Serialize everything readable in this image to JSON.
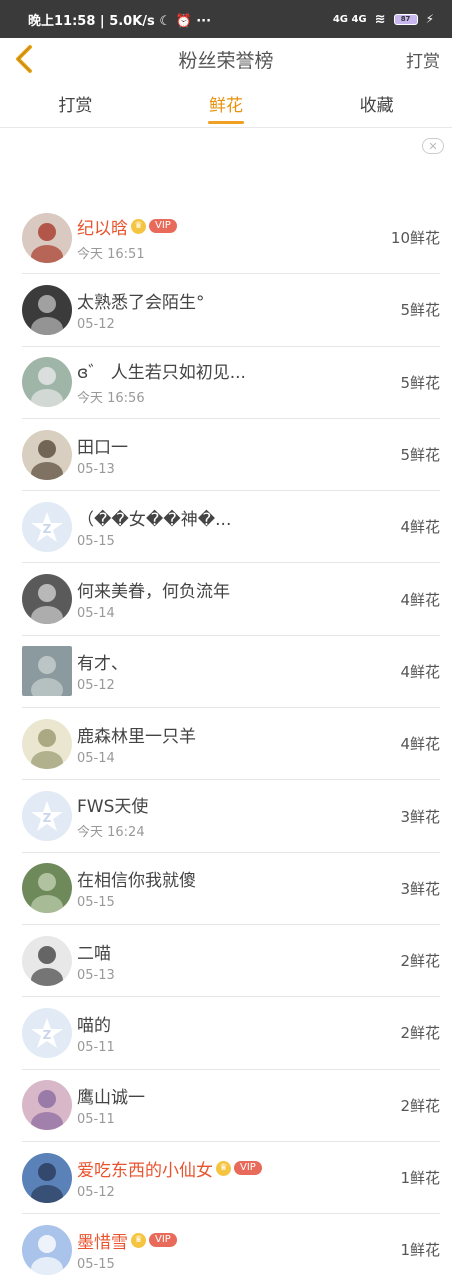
{
  "status_bar": {
    "time": "晚上11:58",
    "speed": "5.0K/s",
    "icons": [
      "moon-icon",
      "alarm-icon",
      "more-icon"
    ],
    "network": "4G 4G",
    "battery": "87"
  },
  "header": {
    "title": "粉丝荣誉榜",
    "right_action": "打赏"
  },
  "tabs": [
    {
      "label": "打赏"
    },
    {
      "label": "鲜花"
    },
    {
      "label": "收藏"
    }
  ],
  "active_tab": "鲜花",
  "ad_close": "✕",
  "vip_label": "VIP",
  "fans": [
    {
      "name": "纪以晗",
      "vip": true,
      "time": "今天 16:51",
      "count": "10鲜花",
      "avatar_bg": "#d9c9c0",
      "avatar_fg": "#a83a2a"
    },
    {
      "name": "太熟悉了会陌生°",
      "vip": false,
      "time": "05-12",
      "count": "5鲜花",
      "avatar_bg": "#3b3b3b",
      "avatar_fg": "#bbbbbb"
    },
    {
      "name": "ɞ゛ 人生若只如初见...",
      "vip": false,
      "time": "今天 16:56",
      "count": "5鲜花",
      "avatar_bg": "#9fb5a8",
      "avatar_fg": "#e8e8e8"
    },
    {
      "name": "田口一",
      "vip": false,
      "time": "05-13",
      "count": "5鲜花",
      "avatar_bg": "#d8cfc0",
      "avatar_fg": "#5a4a3a"
    },
    {
      "name": "（��女��神�...",
      "vip": false,
      "time": "05-15",
      "count": "4鲜花",
      "avatar_bg": "#e4ecf6",
      "avatar_fg": "#ffffff",
      "default_avatar": true
    },
    {
      "name": "何来美眷，何负流年",
      "vip": false,
      "time": "05-14",
      "count": "4鲜花",
      "avatar_bg": "#5a5a5a",
      "avatar_fg": "#d0d0d0"
    },
    {
      "name": "有才、",
      "vip": false,
      "time": "05-12",
      "count": "4鲜花",
      "avatar_bg": "#8a9a9e",
      "avatar_fg": "#c8d0d0",
      "square": true
    },
    {
      "name": "鹿森林里一只羊",
      "vip": false,
      "time": "05-14",
      "count": "4鲜花",
      "avatar_bg": "#eae6d0",
      "avatar_fg": "#9a9a70"
    },
    {
      "name": "FWS天使",
      "vip": false,
      "time": "今天 16:24",
      "count": "3鲜花",
      "avatar_bg": "#e4ecf6",
      "avatar_fg": "#ffffff",
      "default_avatar": true
    },
    {
      "name": "在相信你我就傻",
      "vip": false,
      "time": "05-15",
      "count": "3鲜花",
      "avatar_bg": "#6f8a5a",
      "avatar_fg": "#c0d0b0"
    },
    {
      "name": "二喵",
      "vip": false,
      "time": "05-13",
      "count": "2鲜花",
      "avatar_bg": "#e8e8e8",
      "avatar_fg": "#444444"
    },
    {
      "name": "喵的",
      "vip": false,
      "time": "05-11",
      "count": "2鲜花",
      "avatar_bg": "#e4ecf6",
      "avatar_fg": "#ffffff",
      "default_avatar": true
    },
    {
      "name": "鹰山诚一",
      "vip": false,
      "time": "05-11",
      "count": "2鲜花",
      "avatar_bg": "#d8b8c8",
      "avatar_fg": "#8a6aa0"
    },
    {
      "name": "爱吃东西的小仙女",
      "vip": true,
      "time": "05-12",
      "count": "1鲜花",
      "avatar_bg": "#5a82b8",
      "avatar_fg": "#2a3a5a"
    },
    {
      "name": "墨惜雪",
      "vip": true,
      "time": "05-15",
      "count": "1鲜花",
      "avatar_bg": "#a9c3ea",
      "avatar_fg": "#ffffff"
    }
  ]
}
